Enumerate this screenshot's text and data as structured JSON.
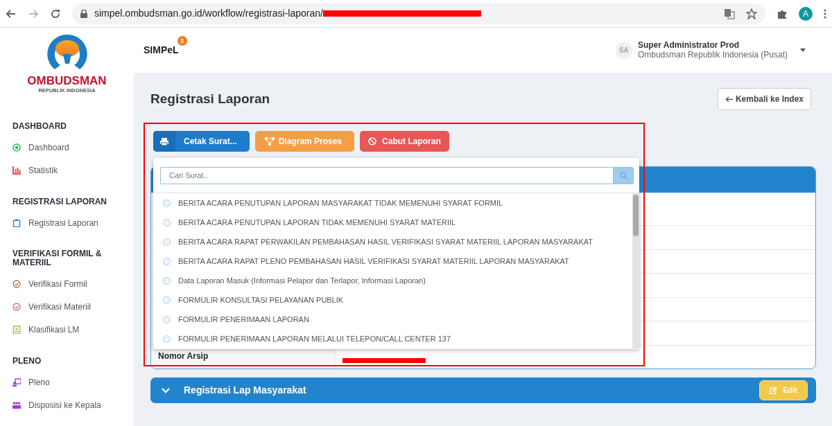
{
  "browser": {
    "url": "simpel.ombudsman.go.id/workflow/registrasi-laporan/",
    "profile_initial": "A"
  },
  "sidebar": {
    "logo_text": "OMBUDSMAN",
    "logo_subtext": "REPUBLIK INDONESIA",
    "sections": [
      {
        "title": "DASHBOARD",
        "items": [
          {
            "label": "Dashboard",
            "color": "#2fbf4f"
          },
          {
            "label": "Statistik",
            "color": "#e8505b"
          }
        ]
      },
      {
        "title": "REGISTRASI LAPORAN",
        "items": [
          {
            "label": "Registrasi Laporan",
            "color": "#2a8ee0"
          }
        ]
      },
      {
        "title": "VERIFIKASI FORMIL & MATERIIL",
        "items": [
          {
            "label": "Verifikasi Formil",
            "color": "#b06a48"
          },
          {
            "label": "Verifikasi Materiil",
            "color": "#e85aa0"
          },
          {
            "label": "Klasifikasi LM",
            "color": "#a6c82a"
          }
        ]
      },
      {
        "title": "PLENO",
        "items": [
          {
            "label": "Pleno",
            "color": "#9b3fd0"
          },
          {
            "label": "Disposisi ke Kepala",
            "color": "#9b3fd0"
          }
        ]
      }
    ]
  },
  "header": {
    "app_name": "SIMPeL",
    "badge": "3",
    "user_initials": "SA",
    "user_name": "Super Administrator Prod",
    "user_org": "Ombudsman Republik Indonesia (Pusat)"
  },
  "page": {
    "title": "Registrasi Laporan",
    "back_button": "Kembali ke Index",
    "actions": [
      {
        "label": "Cetak Surat...",
        "kind": "print"
      },
      {
        "label": "Diagram Proses",
        "kind": "diagram"
      },
      {
        "label": "Cabut Laporan",
        "kind": "revoke"
      }
    ],
    "letter_menu": {
      "search_placeholder": "Cari Surat..",
      "items": [
        {
          "label": "BERITA ACARA PENUTUPAN LAPORAN MASYARAKAT TIDAK MEMENUHI SYARAT FORMIL",
          "selected": false
        },
        {
          "label": "BERITA ACARA PENUTUPAN LAPORAN TIDAK MEMENUHI SYARAT MATERIIL",
          "selected": false
        },
        {
          "label": "BERITA ACARA RAPAT PERWAKILAN PEMBAHASAN HASIL VERIFIKASI SYARAT MATERIIL LAPORAN MASYARAKAT",
          "selected": false
        },
        {
          "label": "BERITA ACARA RAPAT PLENO PEMBAHASAN HASIL VERIFIKASI SYARAT MATERIIL LAPORAN MASYARAKAT",
          "selected": false
        },
        {
          "label": "Data Laporan Masuk (Informasi Pelapor dan Terlapor, Informasi Laporan)",
          "selected": false
        },
        {
          "label": "FORMULIR KONSULTASI PELAYANAN PUBLIK",
          "selected": false
        },
        {
          "label": "FORMULIR PENERIMAAN LAPORAN",
          "selected": false
        },
        {
          "label": "FORMULIR PENERIMAAN LAPORAN MELALUI TELEPON/CALL CENTER 137",
          "selected": false
        }
      ]
    },
    "detail_rows": [
      {
        "label": ""
      },
      {
        "label": ""
      },
      {
        "label": ""
      },
      {
        "label": ""
      },
      {
        "label": ""
      },
      {
        "label": ""
      },
      {
        "label": "Nomor Arsip"
      }
    ],
    "panel": {
      "title": "Registrasi Lap Masyarakat",
      "edit_button": "Edit"
    }
  }
}
